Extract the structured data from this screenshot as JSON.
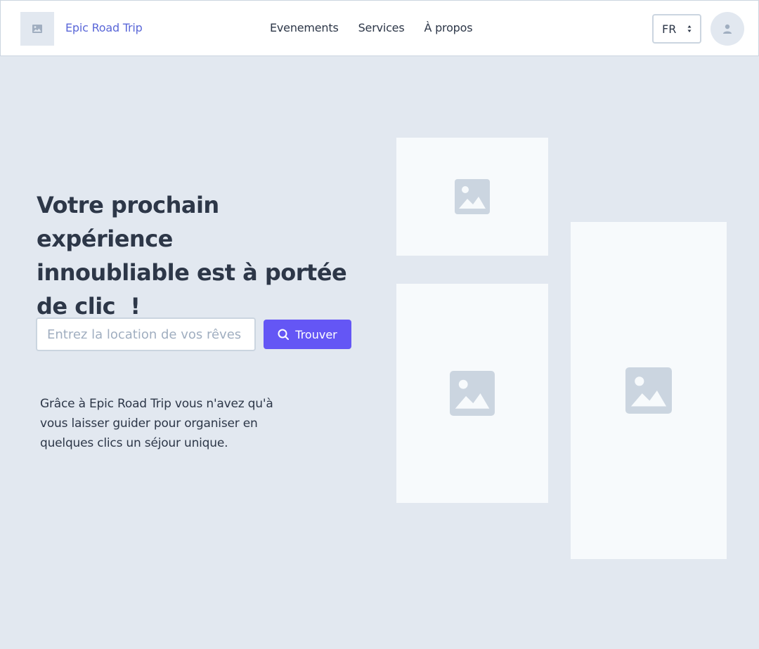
{
  "header": {
    "brand": "Epic Road Trip",
    "logo_icon": "image-icon",
    "nav": [
      "Evenements",
      "Services",
      "À propos"
    ],
    "language": "FR",
    "avatar_icon": "user-icon"
  },
  "hero": {
    "title_lines": [
      "Votre prochain expérience",
      "innoubliable est à portée",
      "de clic  !"
    ],
    "search": {
      "placeholder": "Entrez la location de vos rêves",
      "value": "",
      "button_label": "Trouver",
      "button_icon": "search-icon"
    },
    "description_lines": [
      "Grâce à Epic Road Trip vous n'avez qu'à",
      "vous laisser guider pour organiser en",
      "quelques clics un séjour unique."
    ]
  },
  "gallery": {
    "images": [
      "image-placeholder-icon",
      "image-placeholder-icon",
      "image-placeholder-icon"
    ]
  },
  "colors": {
    "background": "#e2e8f0",
    "accent": "#6456f5",
    "brand_text": "#5a67d8",
    "placeholder_bg": "#f7fafc",
    "icon_gray": "#cbd5e0"
  }
}
